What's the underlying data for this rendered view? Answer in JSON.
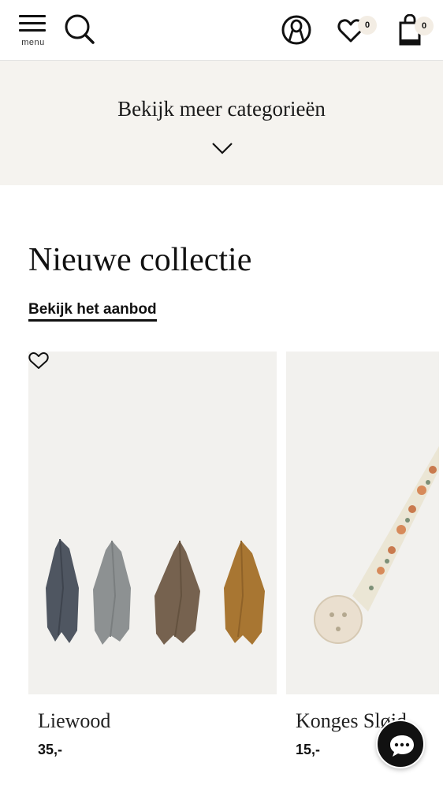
{
  "header": {
    "menu_label": "menu",
    "wishlist_count": "0",
    "cart_count": "0",
    "icons": [
      "menu-icon",
      "search-icon",
      "account-icon",
      "heart-icon",
      "bag-icon"
    ]
  },
  "categories": {
    "label": "Bekijk meer categorieën",
    "icon": "chevron-down-icon"
  },
  "section": {
    "title": "Nieuwe collectie",
    "link": "Bekijk het aanbod"
  },
  "products": [
    {
      "brand": "Liewood",
      "price": "35,-",
      "image": "four hanging muslin cloths in blue, grey, taupe and ochre"
    },
    {
      "brand": "Konges Sløjd",
      "price": "15,-",
      "image": "floral pacifier clip"
    }
  ],
  "chat": {
    "icon": "chat-icon"
  },
  "colors": {
    "band": "#f5f3ef",
    "image_bg": "#f2f1ee",
    "badge": "#f3ede4",
    "text": "#111111"
  }
}
